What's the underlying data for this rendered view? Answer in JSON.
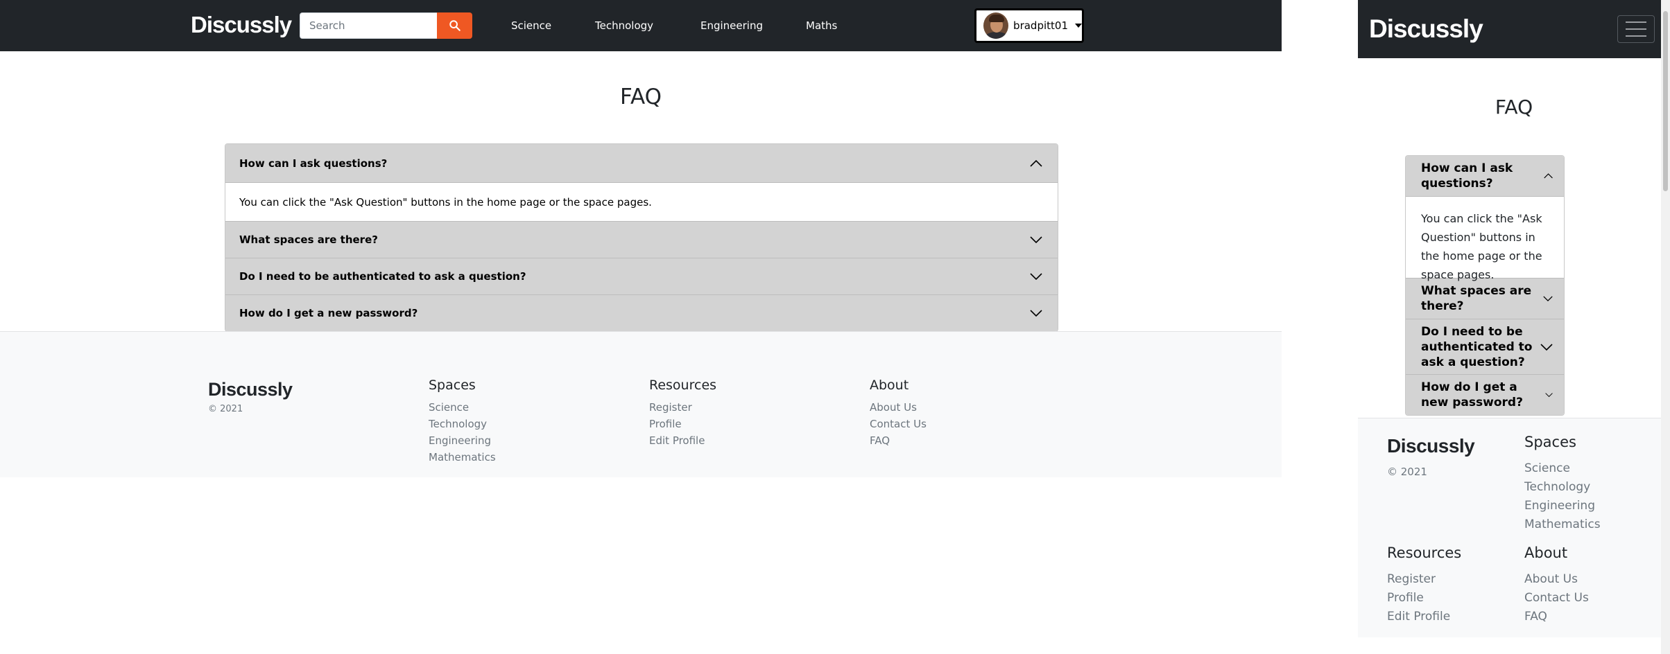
{
  "brand": "Discussly",
  "search": {
    "placeholder": "Search"
  },
  "nav": {
    "links": [
      "Science",
      "Technology",
      "Engineering",
      "Maths"
    ]
  },
  "user": {
    "name": "bradpitt01"
  },
  "page_title": "FAQ",
  "faq": [
    {
      "question": "How can I ask questions?",
      "answer": "You can click the \"Ask Question\" buttons in the home page or the space pages."
    },
    {
      "question": "What spaces are there?"
    },
    {
      "question": "Do I need to be authenticated to ask a question?"
    },
    {
      "question": "How do I get a new password?"
    }
  ],
  "footer": {
    "brand": "Discussly",
    "copyright": "© 2021",
    "spaces": {
      "heading": "Spaces",
      "links": [
        "Science",
        "Technology",
        "Engineering",
        "Mathematics"
      ]
    },
    "resources": {
      "heading": "Resources",
      "links": [
        "Register",
        "Profile",
        "Edit Profile"
      ]
    },
    "about": {
      "heading": "About",
      "links": [
        "About Us",
        "Contact Us",
        "FAQ"
      ]
    }
  },
  "colors": {
    "navbar": "#212529",
    "search_button": "#ef5823",
    "accordion_header": "#d3d3d3",
    "footer_bg": "#f8f9fa"
  },
  "icons": {
    "search_button": "search-icon",
    "accordion_open": "chevron-up-icon",
    "accordion_closed": "chevron-down-icon",
    "menu": "hamburger-icon"
  }
}
